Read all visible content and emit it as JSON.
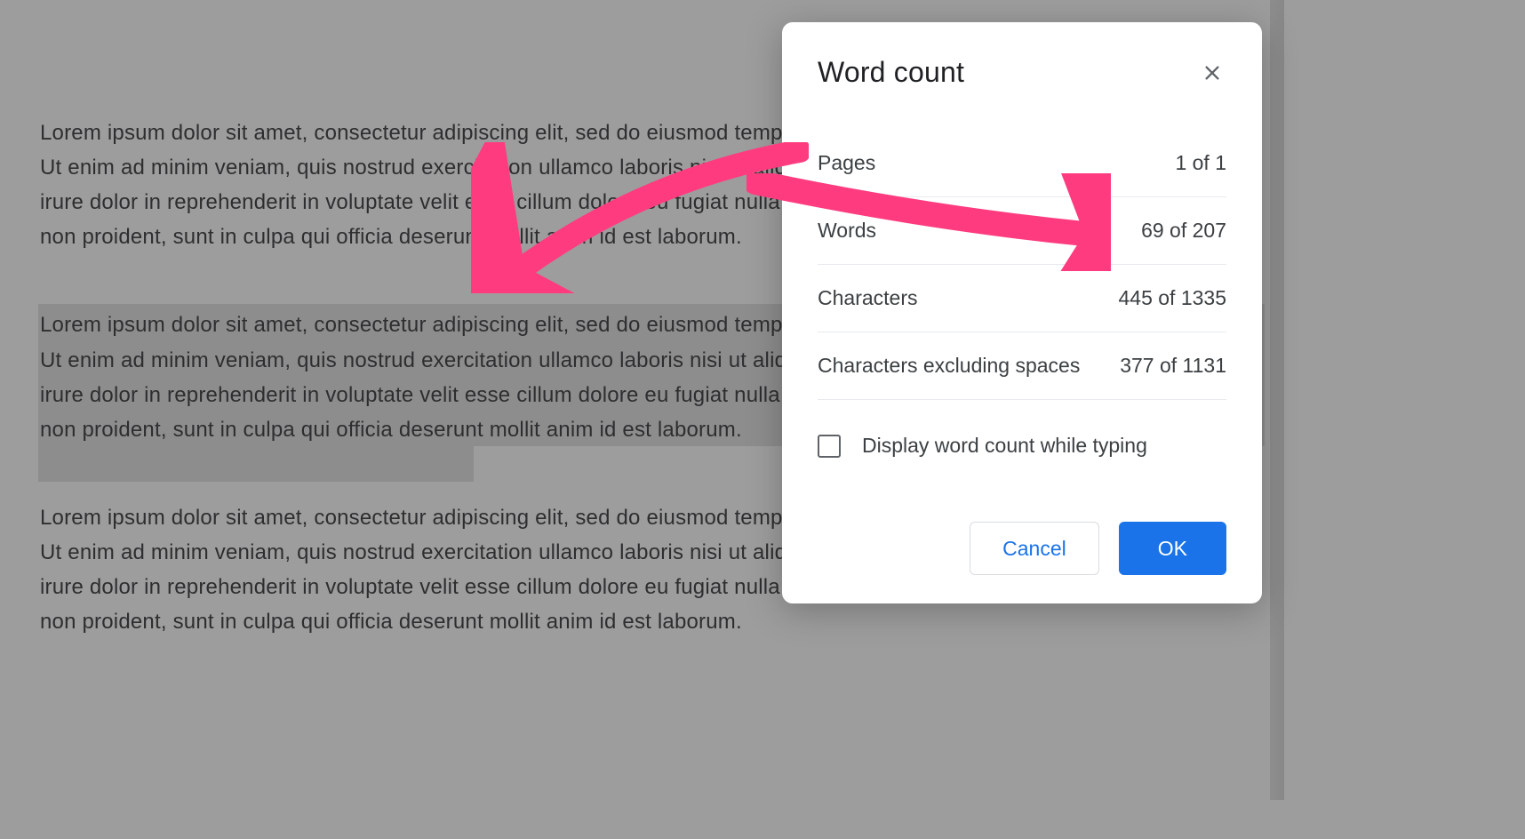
{
  "document": {
    "paragraph1": "Lorem ipsum dolor sit amet, consectetur adipiscing elit, sed do eiusmod tempor incididunt ut labore et dolore magna aliqua. Ut enim ad minim veniam, quis nostrud exercitation ullamco laboris nisi ut aliquip ex ea commodo consequat. Duis aute irure dolor in reprehenderit in voluptate velit esse cillum dolore eu fugiat nulla pariatur. Excepteur sint occaecat cupidatat non proident, sunt in culpa qui officia deserunt mollit anim id est laborum.",
    "paragraph2": "Lorem ipsum dolor sit amet, consectetur adipiscing elit, sed do eiusmod tempor incididunt ut labore et dolore magna aliqua. Ut enim ad minim veniam, quis nostrud exercitation ullamco laboris nisi ut aliquip ex ea commodo consequat. Duis aute irure dolor in reprehenderit in voluptate velit esse cillum dolore eu fugiat nulla pariatur. Excepteur sint occaecat cupidatat non proident, sunt in culpa qui officia deserunt mollit anim id est laborum.",
    "paragraph3": "Lorem ipsum dolor sit amet, consectetur adipiscing elit, sed do eiusmod tempor incididunt ut labore et dolore magna aliqua. Ut enim ad minim veniam, quis nostrud exercitation ullamco laboris nisi ut aliquip ex ea commodo consequat. Duis aute irure dolor in reprehenderit in voluptate velit esse cillum dolore eu fugiat nulla pariatur. Excepteur sint occaecat cupidatat non proident, sunt in culpa qui officia deserunt mollit anim id est laborum.",
    "paragraph2_selected": true
  },
  "dialog": {
    "title": "Word count",
    "stats": {
      "pages": {
        "label": "Pages",
        "value": "1 of 1"
      },
      "words": {
        "label": "Words",
        "value": "69 of 207"
      },
      "characters": {
        "label": "Characters",
        "value": "445 of 1335"
      },
      "characters_no_spaces": {
        "label": "Characters excluding spaces",
        "value": "377 of 1131"
      }
    },
    "checkbox_label": "Display word count while typing",
    "checkbox_checked": false,
    "actions": {
      "cancel": "Cancel",
      "ok": "OK"
    }
  },
  "annotations": {
    "arrow1_target": "selected-paragraph",
    "arrow2_target": "words-stat-value",
    "color": "#ff3b7f"
  }
}
